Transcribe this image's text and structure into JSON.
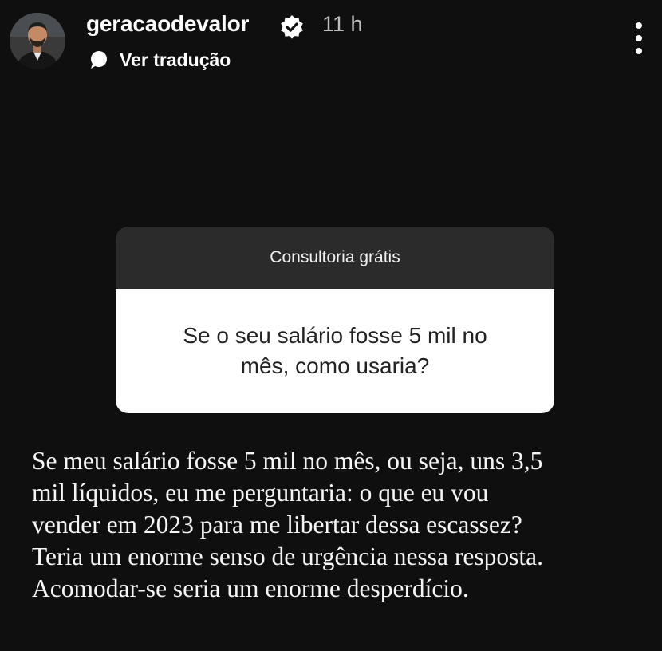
{
  "header": {
    "username": "geracaodevalor",
    "time": "11 h",
    "translate_label": "Ver tradução",
    "avatar_icon": "profile-photo",
    "verified_icon": "verified-badge-icon",
    "more_icon": "more-options-icon"
  },
  "question_box": {
    "title": "Consultoria grátis",
    "question_lines": [
      "Se o seu salário fosse 5 mil no",
      "mês, como usaria?"
    ]
  },
  "answer": {
    "lines": [
      "Se meu salário fosse 5 mil no mês, ou seja, uns 3,5",
      "mil líquidos, eu me perguntaria: o que eu vou",
      "vender em 2023 para me libertar dessa escassez?",
      "Teria um enorme senso de urgência nessa resposta.",
      "Acomodar-se seria um enorme desperdício."
    ]
  },
  "colors": {
    "background": "#0f0f0f",
    "question_header": "#2b2b2b",
    "question_body": "#ffffff",
    "time_text": "#bdbdbd"
  }
}
